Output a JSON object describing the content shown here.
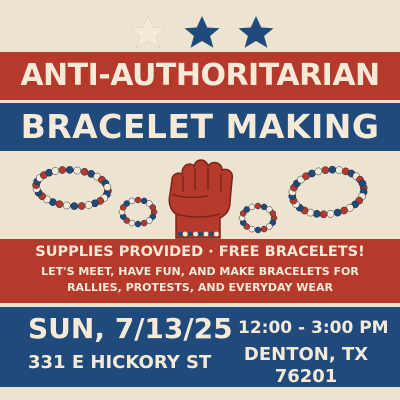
{
  "colors": {
    "background": "#ece3d0",
    "red": "#b53a2c",
    "blue": "#1f4a7b",
    "cream": "#f4ead7"
  },
  "stars": [
    "star-cream",
    "star-blue",
    "star-blue"
  ],
  "title": {
    "line1": "ANTI-AUTHORITARIAN",
    "line2": "BRACELET MAKING"
  },
  "banner": {
    "headline": "SUPPLIES PROVIDED · FREE BRACELETS!",
    "line1": "LET'S MEET, HAVE FUN, AND MAKE BRACELETS FOR",
    "line2": "RALLIES, PROTESTS, AND EVERYDAY WEAR"
  },
  "event": {
    "date": "SUN, 7/13/25",
    "time": "12:00 - 3:00 PM",
    "address": "331 E HICKORY ST",
    "city": "DENTON, TX",
    "zip": "76201"
  },
  "icons": [
    "raised-fist-icon",
    "bead-bracelet-icon"
  ]
}
